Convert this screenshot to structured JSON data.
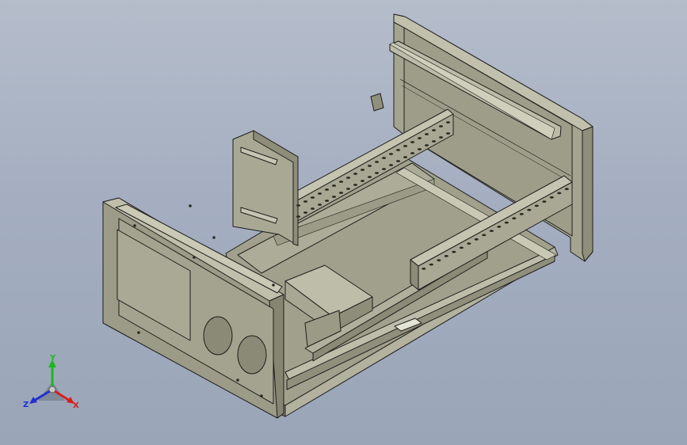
{
  "colors": {
    "background_top": "#b5bdcb",
    "background_bottom": "#9aa5b8",
    "metal_light": "#b8b8a4",
    "metal_mid": "#a5a590",
    "metal_dark": "#8c8c78",
    "edge": "#1e1e1e",
    "axis_x": "#d42020",
    "axis_y": "#1cb81c",
    "axis_z": "#2030d0"
  },
  "triad": {
    "x_label": "X",
    "y_label": "Y",
    "z_label": "Z"
  }
}
